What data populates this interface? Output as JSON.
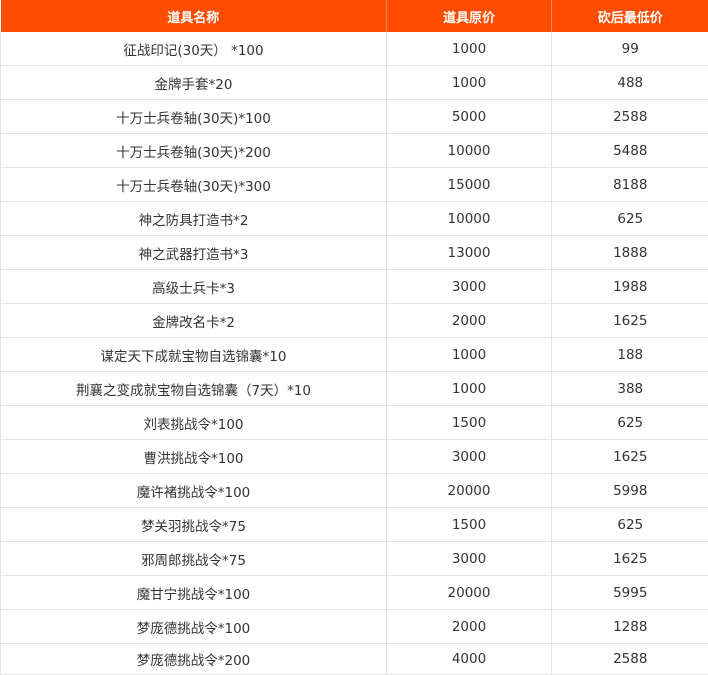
{
  "colors": {
    "header_bg": "#fe4d00",
    "header_text": "#ffffff",
    "cell_text": "#333333",
    "grid": "#e3e3e3"
  },
  "table": {
    "headers": [
      "道具名称",
      "道具原价",
      "砍后最低价"
    ],
    "rows": [
      [
        "征战印记(30天） *100",
        "1000",
        "99"
      ],
      [
        "金牌手套*20",
        "1000",
        "488"
      ],
      [
        "十万士兵卷轴(30天)*100",
        "5000",
        "2588"
      ],
      [
        "十万士兵卷轴(30天)*200",
        "10000",
        "5488"
      ],
      [
        "十万士兵卷轴(30天)*300",
        "15000",
        "8188"
      ],
      [
        "神之防具打造书*2",
        "10000",
        "625"
      ],
      [
        "神之武器打造书*3",
        "13000",
        "1888"
      ],
      [
        "高级士兵卡*3",
        "3000",
        "1988"
      ],
      [
        "金牌改名卡*2",
        "2000",
        "1625"
      ],
      [
        "谋定天下成就宝物自选锦囊*10",
        "1000",
        "188"
      ],
      [
        "荆襄之变成就宝物自选锦囊（7天）*10",
        "1000",
        "388"
      ],
      [
        "刘表挑战令*100",
        "1500",
        "625"
      ],
      [
        "曹洪挑战令*100",
        "3000",
        "1625"
      ],
      [
        "魔许褚挑战令*100",
        "20000",
        "5998"
      ],
      [
        "梦关羽挑战令*75",
        "1500",
        "625"
      ],
      [
        "邪周郎挑战令*75",
        "3000",
        "1625"
      ],
      [
        "魔甘宁挑战令*100",
        "20000",
        "5995"
      ],
      [
        "梦庞德挑战令*100",
        "2000",
        "1288"
      ],
      [
        "梦庞德挑战令*200",
        "4000",
        "2588"
      ]
    ]
  }
}
